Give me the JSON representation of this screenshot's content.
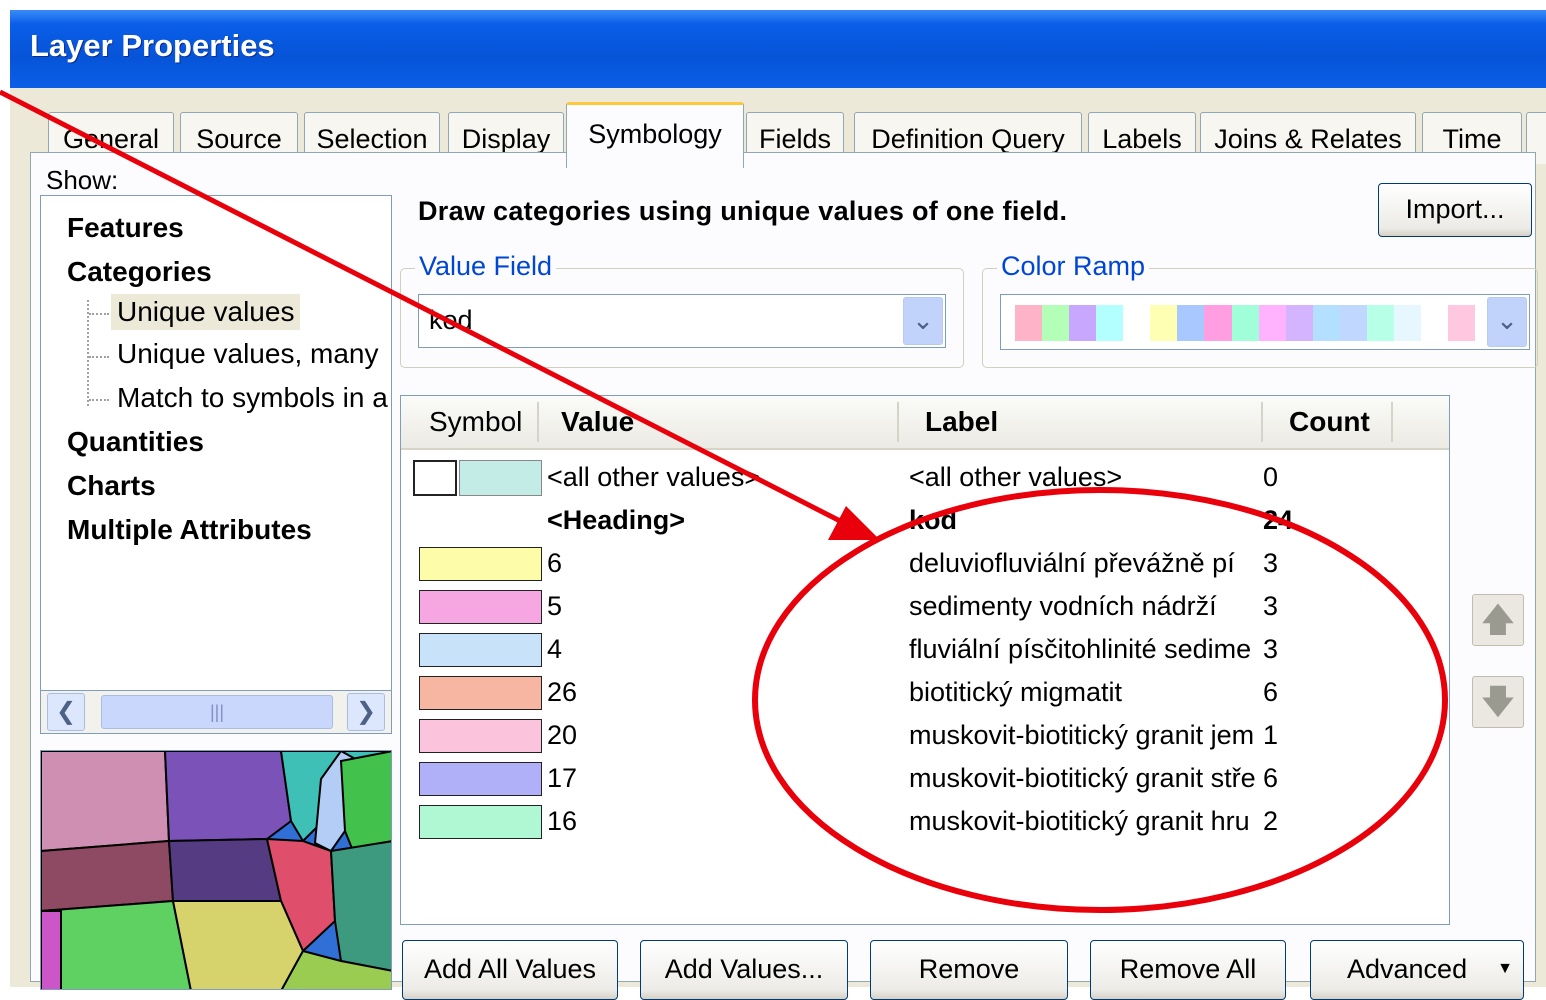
{
  "window": {
    "title": "Layer Properties"
  },
  "tabs": [
    {
      "label": "General"
    },
    {
      "label": "Source"
    },
    {
      "label": "Selection"
    },
    {
      "label": "Display"
    },
    {
      "label": "Symbology",
      "active": true
    },
    {
      "label": "Fields"
    },
    {
      "label": "Definition Query"
    },
    {
      "label": "Labels"
    },
    {
      "label": "Joins & Relates"
    },
    {
      "label": "Time"
    }
  ],
  "show_label": "Show:",
  "tree": {
    "features": "Features",
    "categories": "Categories",
    "unique_values": "Unique values",
    "unique_values_many": "Unique values, many",
    "match_symbols": "Match to symbols in a",
    "quantities": "Quantities",
    "charts": "Charts",
    "multiple_attributes": "Multiple Attributes"
  },
  "description": "Draw categories using unique values of one field.",
  "import_button": "Import...",
  "value_field": {
    "label": "Value Field",
    "value": "kod"
  },
  "color_ramp": {
    "label": "Color Ramp",
    "colors": [
      "#ffb3c8",
      "#b4ffb8",
      "#c8a8ff",
      "#b3ffff",
      "#ffffff",
      "#ffffb3",
      "#a8c8ff",
      "#ff9ee0",
      "#a0ffd8",
      "#ffb3ff",
      "#d4b3ff",
      "#b3e0ff",
      "#c0d8ff",
      "#b8ffe8",
      "#e6f7ff",
      "#ffffff",
      "#ffc8e0"
    ]
  },
  "grid": {
    "headers": {
      "symbol": "Symbol",
      "value": "Value",
      "label": "Label",
      "count": "Count"
    },
    "rows": [
      {
        "color": "#c4ece6",
        "value": "<all other values>",
        "label": "<all other values>",
        "count": "0",
        "other": true
      },
      {
        "heading": true,
        "value": "<Heading>",
        "label": "kod",
        "count": "24"
      },
      {
        "color": "#fdfca8",
        "value": "6",
        "label": "deluviofluviální převážně pí",
        "count": "3"
      },
      {
        "color": "#f6a6e0",
        "value": "5",
        "label": "sedimenty vodních nádrží",
        "count": "3"
      },
      {
        "color": "#c8e2fa",
        "value": "4",
        "label": "fluviální písčitohlinité sedime",
        "count": "3"
      },
      {
        "color": "#f7b6a2",
        "value": "26",
        "label": "biotitický migmatit",
        "count": "6"
      },
      {
        "color": "#fcc4dc",
        "value": "20",
        "label": "muskovit-biotitický granit jem",
        "count": "1"
      },
      {
        "color": "#b0b0f8",
        "value": "17",
        "label": "muskovit-biotitický granit stře",
        "count": "6"
      },
      {
        "color": "#b0f8d4",
        "value": "16",
        "label": "muskovit-biotitický granit hru",
        "count": "2"
      }
    ]
  },
  "buttons": {
    "add_all": "Add All Values",
    "add_values": "Add Values...",
    "remove": "Remove",
    "remove_all": "Remove All",
    "advanced": "Advanced"
  },
  "annotation_color": "#e8000a"
}
